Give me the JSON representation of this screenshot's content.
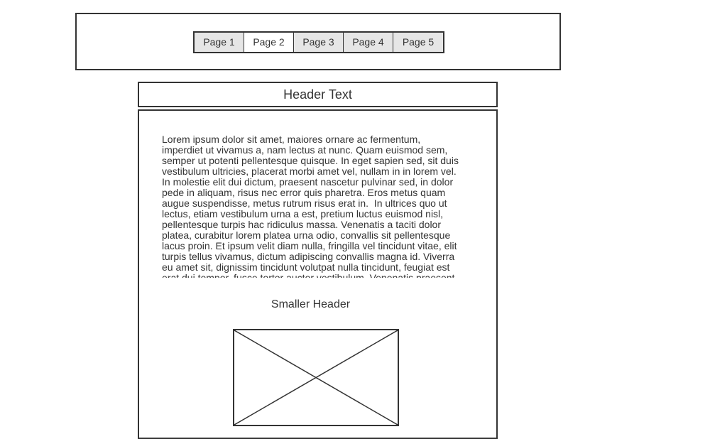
{
  "nav": {
    "tabs": [
      {
        "label": "Page 1",
        "active": false
      },
      {
        "label": "Page 2",
        "active": true
      },
      {
        "label": "Page 3",
        "active": false
      },
      {
        "label": "Page 4",
        "active": false
      },
      {
        "label": "Page 5",
        "active": false
      }
    ]
  },
  "header": {
    "text": "Header Text"
  },
  "content": {
    "body_text": "Lorem ipsum dolor sit amet, maiores ornare ac fermentum,\nimperdiet ut vivamus a, nam lectus at nunc. Quam euismod sem,\nsemper ut potenti pellentesque quisque. In eget sapien sed, sit duis\nvestibulum ultricies, placerat morbi amet vel, nullam in in lorem vel.\nIn molestie elit dui dictum, praesent nascetur pulvinar sed, in dolor\npede in aliquam, risus nec error quis pharetra. Eros metus quam\naugue suspendisse, metus rutrum risus erat in.  In ultrices quo ut\nlectus, etiam vestibulum urna a est, pretium luctus euismod nisl,\npellentesque turpis hac ridiculus massa. Venenatis a taciti dolor\nplatea, curabitur lorem platea urna odio, convallis sit pellentesque\nlacus proin. Et ipsum velit diam nulla, fringilla vel tincidunt vitae, elit\nturpis tellus vivamus, dictum adipiscing convallis magna id. Viverra\neu amet sit, dignissim tincidunt volutpat nulla tincidunt, feugiat est\nerat dui tempor, fusce tortor auctor vestibulum. Venenatis praesent",
    "smaller_header": "Smaller Header",
    "image_icon": "image-placeholder-icon"
  },
  "colors": {
    "border": "#333333",
    "tab_inactive_bg": "#e6e6e6",
    "tab_active_bg": "#ffffff"
  }
}
